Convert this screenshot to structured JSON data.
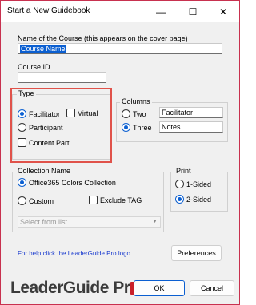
{
  "window": {
    "title": "Start a New Guidebook"
  },
  "titlebar": {
    "minimize_icon": "minimize-icon",
    "maximize_icon": "maximize-icon",
    "close_icon": "close-icon",
    "minimize_glyph": "—",
    "maximize_glyph": "☐",
    "close_glyph": "✕"
  },
  "course": {
    "name_label": "Name of the Course (this appears on the cover page)",
    "name_value": "Course Name",
    "id_label": "Course ID",
    "id_value": ""
  },
  "type": {
    "title": "Type",
    "options": [
      {
        "label": "Facilitator",
        "kind": "radio",
        "checked": true
      },
      {
        "label": "Virtual",
        "kind": "checkbox",
        "checked": false
      },
      {
        "label": "Participant",
        "kind": "radio",
        "checked": false
      },
      {
        "label": "Content Part",
        "kind": "checkbox",
        "checked": false
      }
    ]
  },
  "columns": {
    "title": "Columns",
    "two_label": "Two",
    "three_label": "Three",
    "selected": "Three",
    "col1_value": "Facilitator",
    "col2_value": "Notes"
  },
  "collection": {
    "title": "Collection Name",
    "option1": "Office365 Colors Collection",
    "option1_checked": true,
    "custom_label": "Custom",
    "exclude_label": "Exclude TAG",
    "select_placeholder": "Select from list"
  },
  "print": {
    "title": "Print",
    "one_sided": "1-Sided",
    "two_sided": "2-Sided",
    "selected": "2-Sided"
  },
  "help_text": "For help click the LeaderGuide Pro logo.",
  "buttons": {
    "preferences": "Preferences",
    "ok": "OK",
    "cancel": "Cancel"
  },
  "logo": {
    "text": "LeaderGuide Pr",
    "mark_color": "#c8202a"
  },
  "colors": {
    "accent": "#0b5fd1",
    "highlight": "#e0524a",
    "link": "#1b3ccf"
  }
}
